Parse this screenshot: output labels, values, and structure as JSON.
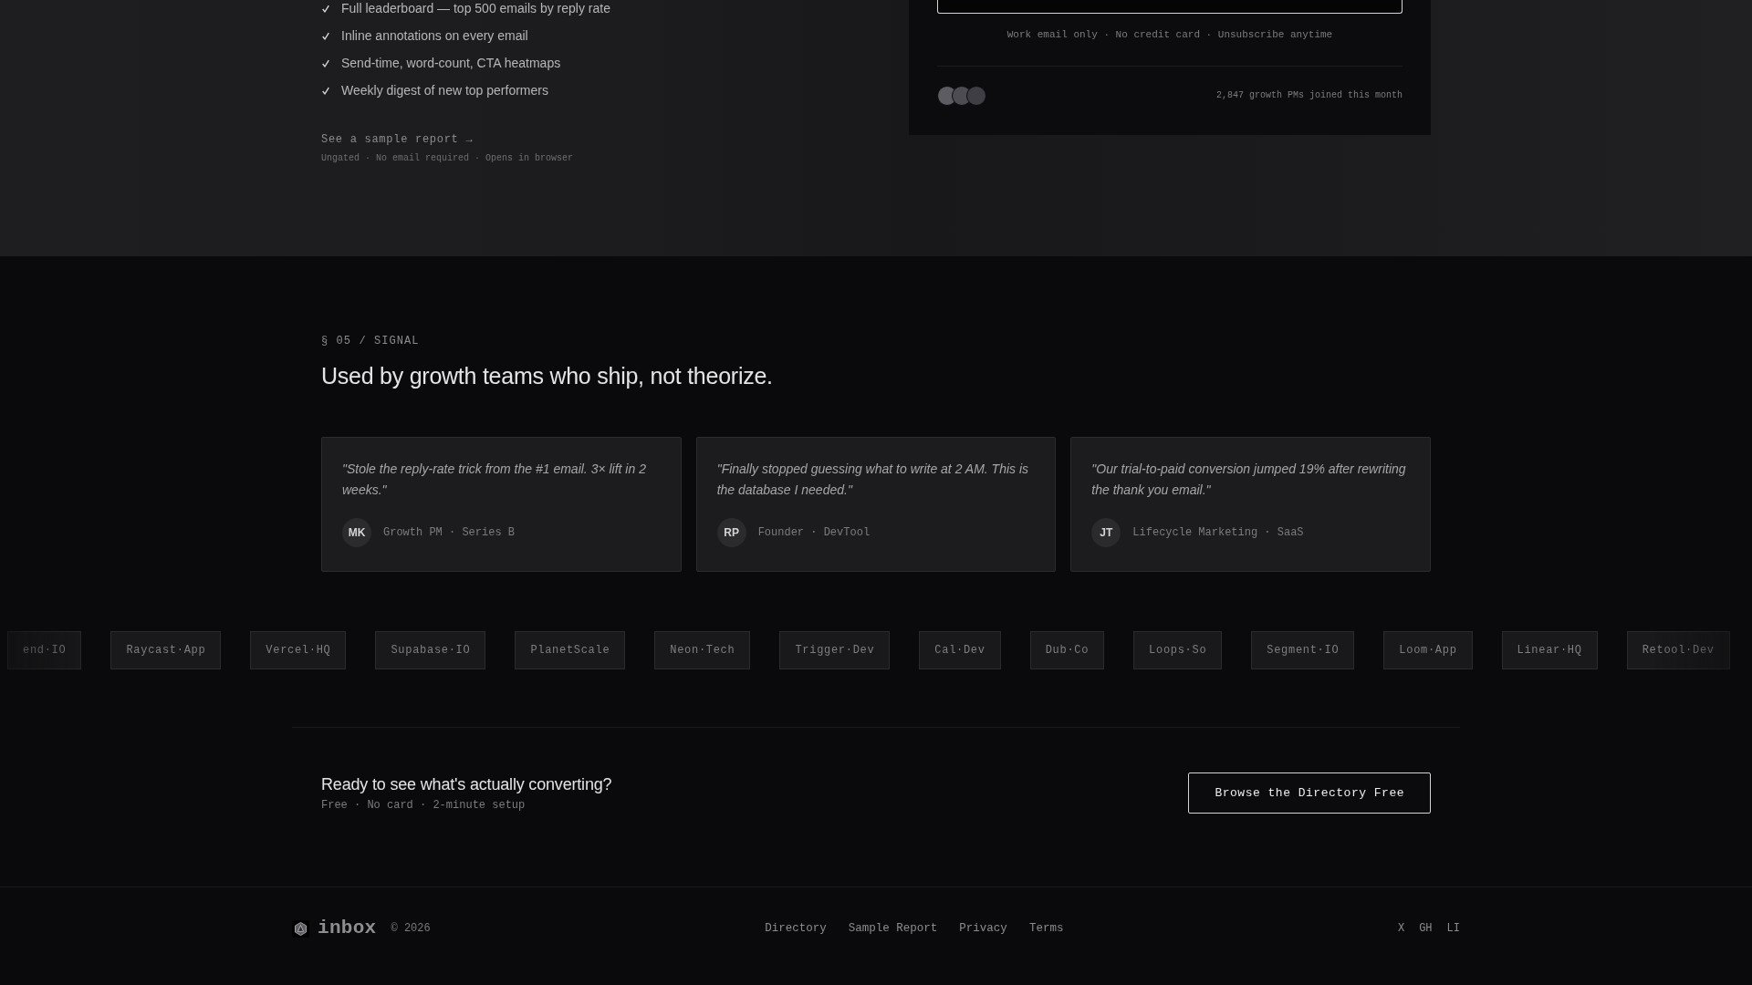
{
  "features": {
    "items": [
      "Full leaderboard — top 500 emails by reply rate",
      "Inline annotations on every email",
      "Send-time, word-count, CTA heatmaps",
      "Weekly digest of new top performers"
    ],
    "sample_link": "See a sample report →",
    "sample_note": "Ungated · No email required · Opens in browser"
  },
  "signup_card": {
    "microcopy": "Work email only · No credit card · Unsubscribe anytime",
    "social_proof": "2,847 growth PMs joined this month"
  },
  "signal": {
    "eyebrow": "§ 05 / SIGNAL",
    "heading": "Used by growth teams who ship, not theorize.",
    "testimonials": [
      {
        "quote": "\"Stole the reply-rate trick from the #1 email. 3× lift in 2 weeks.\"",
        "initials": "MK",
        "role": "Growth PM · Series B"
      },
      {
        "quote": "\"Finally stopped guessing what to write at 2 AM. This is the database I needed.\"",
        "initials": "RP",
        "role": "Founder · DevTool"
      },
      {
        "quote": "\"Our trial-to-paid conversion jumped 19% after rewriting the thank you email.\"",
        "initials": "JT",
        "role": "Lifecycle Marketing · SaaS"
      }
    ],
    "logos": [
      "end·IO",
      "Raycast·App",
      "Vercel·HQ",
      "Supabase·IO",
      "PlanetScale",
      "Neon·Tech",
      "Trigger·Dev",
      "Cal·Dev",
      "Dub·Co",
      "Loops·So",
      "Segment·IO",
      "Loom·App",
      "Linear·HQ",
      "Retool·Dev"
    ]
  },
  "cta": {
    "title": "Ready to see what's actually converting?",
    "subtitle": "Free · No card · 2-minute setup",
    "button": "Browse the Directory Free"
  },
  "footer": {
    "brand": "inbox",
    "copyright": "© 2026",
    "links": [
      "Directory",
      "Sample Report",
      "Privacy",
      "Terms"
    ],
    "social": [
      "X",
      "GH",
      "LI"
    ]
  }
}
